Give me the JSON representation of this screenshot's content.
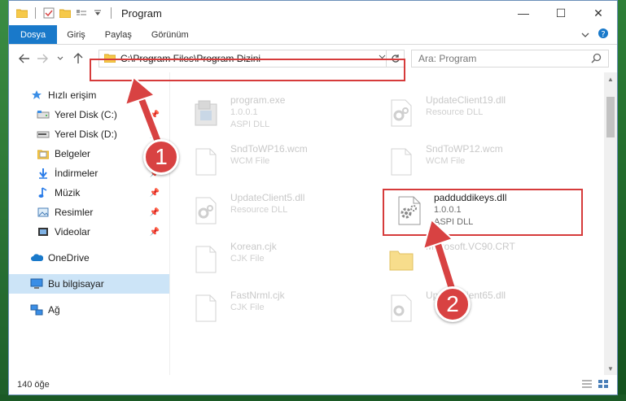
{
  "window": {
    "title": "Program",
    "controls": {
      "minimize": "—",
      "maximize": "☐",
      "close": "✕"
    }
  },
  "ribbon": {
    "tabs": [
      {
        "label": "Dosya"
      },
      {
        "label": "Giriş"
      },
      {
        "label": "Paylaş"
      },
      {
        "label": "Görünüm"
      }
    ]
  },
  "address": {
    "path": "C:\\Program Files\\Program Dizini",
    "search_placeholder": "Ara: Program"
  },
  "nav": {
    "quick_access": "Hızlı erişim",
    "items": [
      {
        "label": "Yerel Disk (C:)",
        "icon": "drive-icon"
      },
      {
        "label": "Yerel Disk (D:)",
        "icon": "drive-icon"
      },
      {
        "label": "Belgeler",
        "icon": "documents-icon"
      },
      {
        "label": "İndirmeler",
        "icon": "downloads-icon"
      },
      {
        "label": "Müzik",
        "icon": "music-icon"
      },
      {
        "label": "Resimler",
        "icon": "pictures-icon"
      },
      {
        "label": "Videolar",
        "icon": "videos-icon"
      }
    ],
    "onedrive": "OneDrive",
    "this_pc": "Bu bilgisayar",
    "network": "Ağ"
  },
  "files": [
    {
      "name": "program.exe",
      "line2": "1.0.0.1",
      "line3": "ASPI DLL"
    },
    {
      "name": "UpdateClient19.dll",
      "line2": "Resource DLL",
      "line3": ""
    },
    {
      "name": "SndToWP16.wcm",
      "line2": "WCM File",
      "line3": ""
    },
    {
      "name": "SndToWP12.wcm",
      "line2": "WCM File",
      "line3": ""
    },
    {
      "name": "UpdateClient5.dll",
      "line2": "Resource DLL",
      "line3": ""
    },
    {
      "name": "padduddikeys.dll",
      "line2": "1.0.0.1",
      "line3": "ASPI DLL"
    },
    {
      "name": "Korean.cjk",
      "line2": "CJK File",
      "line3": ""
    },
    {
      "name": "Microsoft.VC90.CRT",
      "line2": "",
      "line3": ""
    },
    {
      "name": "FastNrml.cjk",
      "line2": "CJK File",
      "line3": ""
    },
    {
      "name": "UpdateClient65.dll",
      "line2": "",
      "line3": ""
    }
  ],
  "status": {
    "count": "140 öğe"
  },
  "callouts": {
    "one": "1",
    "two": "2"
  },
  "colors": {
    "accent": "#1979ca",
    "highlight": "#d63b3b",
    "selection": "#cce4f7"
  }
}
